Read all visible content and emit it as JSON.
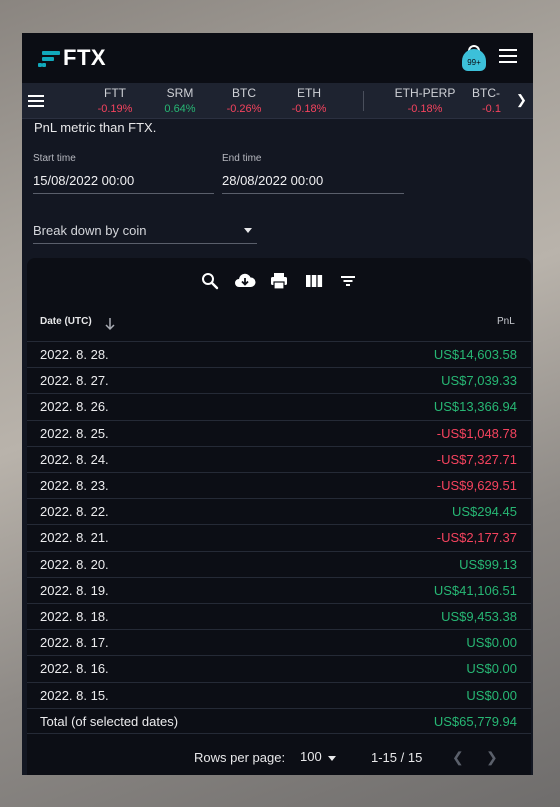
{
  "header": {
    "logo_text": "FTX",
    "notification_badge": "99+"
  },
  "ticker": [
    {
      "symbol": "FTT",
      "change": "-0.19%",
      "direction": "down"
    },
    {
      "symbol": "SRM",
      "change": "0.64%",
      "direction": "up"
    },
    {
      "symbol": "BTC",
      "change": "-0.26%",
      "direction": "down"
    },
    {
      "symbol": "ETH",
      "change": "-0.18%",
      "direction": "down"
    },
    {
      "symbol": "ETH-PERP",
      "change": "-0.18%",
      "direction": "down"
    },
    {
      "symbol": "BTC-",
      "change": "-0.1",
      "direction": "down"
    }
  ],
  "intro_text": "PnL metric than FTX.",
  "filters": {
    "start_label": "Start time",
    "start_value": "15/08/2022 00:00",
    "end_label": "End time",
    "end_value": "28/08/2022 00:00",
    "breakdown_value": "Break down by coin"
  },
  "toolbar_icons": [
    "search-icon",
    "download-icon",
    "print-icon",
    "columns-icon",
    "filter-icon"
  ],
  "table": {
    "col_date": "Date (UTC)",
    "col_pnl": "PnL",
    "rows": [
      {
        "date": "2022. 8. 28.",
        "pnl": "US$14,603.58",
        "sign": "pos"
      },
      {
        "date": "2022. 8. 27.",
        "pnl": "US$7,039.33",
        "sign": "pos"
      },
      {
        "date": "2022. 8. 26.",
        "pnl": "US$13,366.94",
        "sign": "pos"
      },
      {
        "date": "2022. 8. 25.",
        "pnl": "-US$1,048.78",
        "sign": "neg"
      },
      {
        "date": "2022. 8. 24.",
        "pnl": "-US$7,327.71",
        "sign": "neg"
      },
      {
        "date": "2022. 8. 23.",
        "pnl": "-US$9,629.51",
        "sign": "neg"
      },
      {
        "date": "2022. 8. 22.",
        "pnl": "US$294.45",
        "sign": "pos"
      },
      {
        "date": "2022. 8. 21.",
        "pnl": "-US$2,177.37",
        "sign": "neg"
      },
      {
        "date": "2022. 8. 20.",
        "pnl": "US$99.13",
        "sign": "pos"
      },
      {
        "date": "2022. 8. 19.",
        "pnl": "US$41,106.51",
        "sign": "pos"
      },
      {
        "date": "2022. 8. 18.",
        "pnl": "US$9,453.38",
        "sign": "pos"
      },
      {
        "date": "2022. 8. 17.",
        "pnl": "US$0.00",
        "sign": "pos"
      },
      {
        "date": "2022. 8. 16.",
        "pnl": "US$0.00",
        "sign": "pos"
      },
      {
        "date": "2022. 8. 15.",
        "pnl": "US$0.00",
        "sign": "pos"
      }
    ],
    "total_label": "Total (of selected dates)",
    "total_value": "US$65,779.94"
  },
  "pagination": {
    "rows_per_page_label": "Rows per page:",
    "rows_per_page_value": "100",
    "range_text": "1-15 / 15"
  },
  "colors": {
    "positive": "#27b774",
    "negative": "#f5435e",
    "accent": "#11a9bc"
  }
}
